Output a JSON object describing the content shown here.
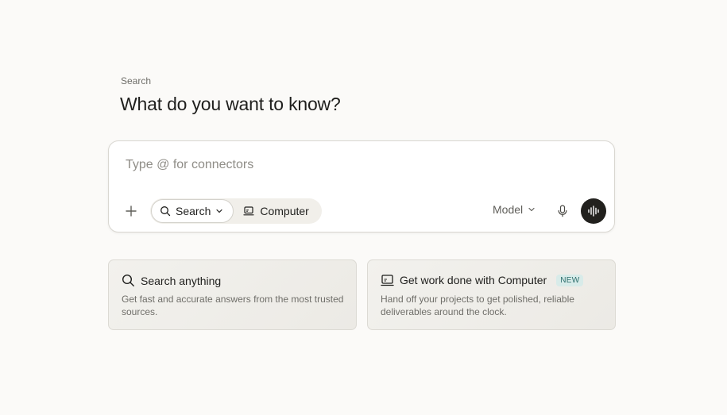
{
  "header": {
    "eyebrow": "Search",
    "title": "What do you want to know?"
  },
  "composer": {
    "placeholder": "Type @ for connectors",
    "modes": [
      {
        "label": "Search",
        "icon": "search-icon",
        "selected": true
      },
      {
        "label": "Computer",
        "icon": "computer-icon",
        "selected": false
      }
    ],
    "model_label": "Model"
  },
  "cards": [
    {
      "icon": "search-icon",
      "title": "Search anything",
      "description": "Get fast and accurate answers from the most trusted sources."
    },
    {
      "icon": "computer-icon",
      "title": "Get work done with Computer",
      "badge": "NEW",
      "description": "Hand off your projects to get polished, reliable deliverables around the clock."
    }
  ],
  "colors": {
    "background": "#fbfaf8",
    "voice_button": "#22211e",
    "badge_bg": "#d8ebe9",
    "badge_text": "#2d6e6c"
  }
}
